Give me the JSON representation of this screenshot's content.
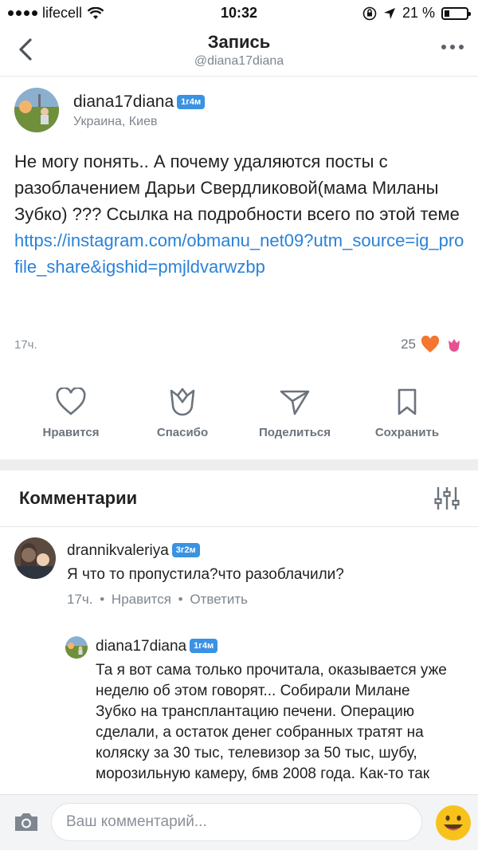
{
  "status_bar": {
    "carrier": "lifecell",
    "time": "10:32",
    "battery": "21 %"
  },
  "header": {
    "title": "Запись",
    "subtitle": "@diana17diana"
  },
  "post": {
    "author": "diana17diana",
    "author_badge": "1г4м",
    "location": "Украина, Киев",
    "text": "Не могу понять.. А почему удаляются посты с разоблачением Дарьи Свердликовой(мама Миланы Зубко) ??? Ссылка на подробности всего по этой теме",
    "link": "https://instagram.com/obmanu_net09?utm_source=ig_profile_share&igshid=pmjldvarwzbp",
    "time": "17ч.",
    "reactions_count": "25"
  },
  "actions": {
    "like": "Нравится",
    "thanks": "Спасибо",
    "share": "Поделиться",
    "save": "Сохранить"
  },
  "comments": {
    "title": "Комментарии",
    "items": [
      {
        "author": "drannikvaleriya",
        "badge": "3г2м",
        "text": "Я что то пропустила?что разоблачили?",
        "time": "17ч.",
        "like": "Нравится",
        "reply": "Ответить"
      },
      {
        "author": "diana17diana",
        "badge": "1г4м",
        "text": "Та я вот сама только прочитала, оказывается уже неделю об этом говорят... Собирали Милане Зубко на трансплантацию печени. Операцию сделали, а остаток денег собранных тратят на коляску за 30 тыс, телевизор за 50 тыс, шубу, морозильную камеру, бмв 2008 года. Как-то так"
      }
    ]
  },
  "input": {
    "placeholder": "Ваш комментарий..."
  }
}
